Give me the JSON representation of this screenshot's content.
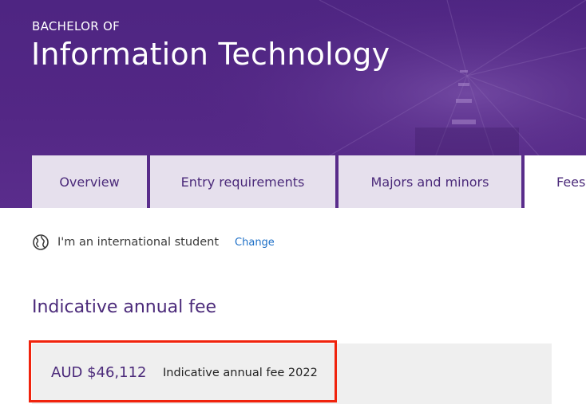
{
  "hero": {
    "eyebrow": "BACHELOR OF",
    "title": "Information Technology"
  },
  "tabs": [
    {
      "label": "Overview",
      "active": false
    },
    {
      "label": "Entry requirements",
      "active": false
    },
    {
      "label": "Majors and minors",
      "active": false
    },
    {
      "label": "Fees",
      "active": true
    }
  ],
  "student_type": {
    "icon": "globe-icon",
    "label": "I'm an international student",
    "change_label": "Change"
  },
  "fees": {
    "heading": "Indicative annual fee",
    "amount": "AUD $46,112",
    "caption": "Indicative annual fee 2022"
  },
  "colors": {
    "brand_purple": "#532785",
    "tab_background": "#e6e0ed",
    "heading_purple": "#4b2a7a",
    "link_blue": "#1c6fc7",
    "fee_box_background": "#efefef",
    "highlight_red": "#f0230d"
  }
}
